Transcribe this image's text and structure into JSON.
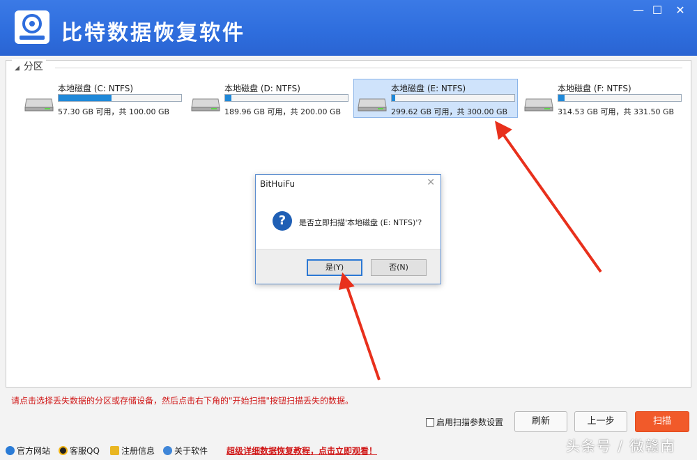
{
  "window": {
    "title": "比特数据恢复软件",
    "controls": {
      "minimize": "—",
      "maximize": "☐",
      "close": "✕"
    }
  },
  "partitions": {
    "heading": "分区",
    "drives": [
      {
        "name": "本地磁盘 (C: NTFS)",
        "info": "57.30 GB 可用，共 100.00 GB",
        "used_fraction": 0.43,
        "selected": false
      },
      {
        "name": "本地磁盘 (D: NTFS)",
        "info": "189.96 GB 可用，共 200.00 GB",
        "used_fraction": 0.05,
        "selected": false
      },
      {
        "name": "本地磁盘 (E: NTFS)",
        "info": "299.62 GB 可用，共 300.00 GB",
        "used_fraction": 0.01,
        "selected": true
      },
      {
        "name": "本地磁盘 (F: NTFS)",
        "info": "314.53 GB 可用，共 331.50 GB",
        "used_fraction": 0.05,
        "selected": false
      }
    ]
  },
  "hint": "请点击选择丢失数据的分区或存储设备，然后点击右下角的\"开始扫描\"按钮扫描丢失的数据。",
  "controls": {
    "scan_params_label": "启用扫描参数设置",
    "refresh": "刷新",
    "prev": "上一步",
    "scan": "扫描"
  },
  "footer": {
    "website": "官方网站",
    "qq": "客服QQ",
    "register": "注册信息",
    "about": "关于软件",
    "tutorial_link": "超级详细数据恢复教程，点击立即观看！"
  },
  "watermark": "头条号 / 微赣南",
  "dialog": {
    "title": "BitHuiFu",
    "message": "是否立即扫描'本地磁盘 (E: NTFS)'?",
    "yes": "是(Y)",
    "no": "否(N)"
  },
  "colors": {
    "titlebar": "#2e6ddd",
    "accent_scan": "#f15a2a",
    "hint_red": "#d01818",
    "selected_bg": "#cfe3fb"
  }
}
